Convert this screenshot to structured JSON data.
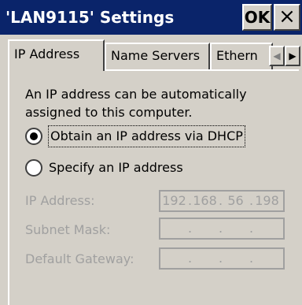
{
  "window": {
    "title": "'LAN9115' Settings",
    "ok_label": "OK",
    "close_label": "×"
  },
  "tabs": [
    {
      "label": "IP Address",
      "active": true
    },
    {
      "label": "Name Servers",
      "active": false
    },
    {
      "label": "Ethern",
      "active": false
    }
  ],
  "tab_scroll": {
    "left_icon": "◀",
    "right_icon": "▶"
  },
  "ip_tab": {
    "description": "An IP address can be automatically assigned to this computer.",
    "options": [
      {
        "label": "Obtain an IP address via DHCP",
        "selected": true
      },
      {
        "label": "Specify an IP address",
        "selected": false
      }
    ],
    "fields": [
      {
        "label": "IP Address:",
        "octets": [
          "192",
          "168",
          "56",
          "198"
        ],
        "enabled": false
      },
      {
        "label": "Subnet Mask:",
        "octets": [
          "",
          "",
          "",
          ""
        ],
        "enabled": false
      },
      {
        "label": "Default Gateway:",
        "octets": [
          "",
          "",
          "",
          ""
        ],
        "enabled": false
      }
    ],
    "separator": "."
  }
}
